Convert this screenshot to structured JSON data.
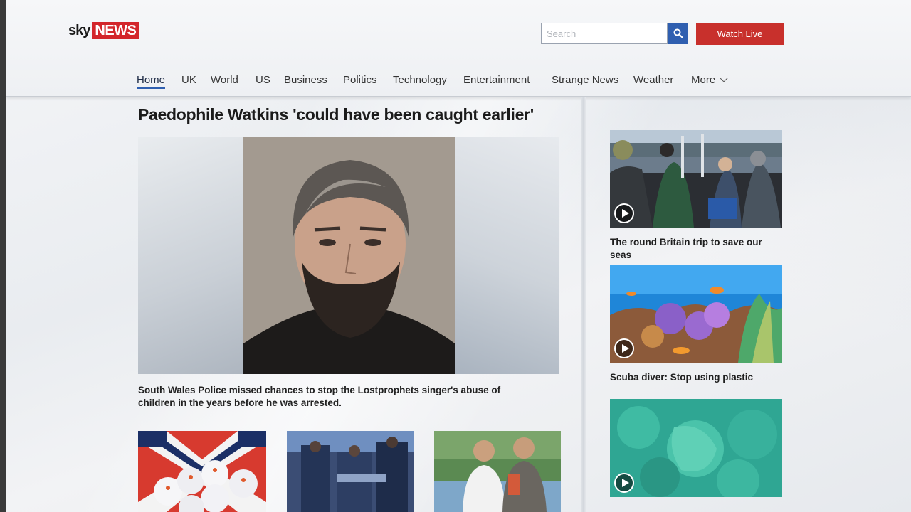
{
  "brand": {
    "logo_sky": "sky",
    "logo_news": "NEWS",
    "accent": "#d3262b"
  },
  "search": {
    "placeholder": "Search"
  },
  "header": {
    "watch_live_label": "Watch Live"
  },
  "nav": {
    "items": [
      {
        "label": "Home",
        "active": true
      },
      {
        "label": "UK"
      },
      {
        "label": "World"
      },
      {
        "label": "US"
      },
      {
        "label": "Business"
      },
      {
        "label": "Politics"
      },
      {
        "label": "Technology"
      },
      {
        "label": "Entertainment"
      },
      {
        "label": "Strange News"
      },
      {
        "label": "Weather"
      },
      {
        "label": "More"
      }
    ]
  },
  "main": {
    "headline": "Paedophile Watkins 'could have been caught earlier'",
    "caption": "South Wales Police missed chances to stop the Lostprophets singer's abuse of children in the years before he was arrested."
  },
  "sidebar": {
    "stories": [
      {
        "caption": "The round Britain trip to save our seas",
        "has_video": true
      },
      {
        "caption": "Scuba diver: Stop using plastic",
        "has_video": true
      },
      {
        "caption": "",
        "has_video": true
      }
    ]
  }
}
